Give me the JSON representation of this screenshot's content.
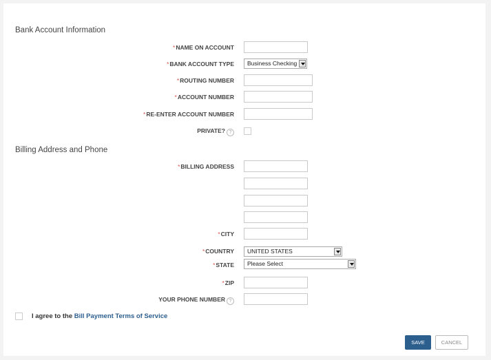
{
  "sections": {
    "bank": "Bank Account Information",
    "billing": "Billing Address and Phone"
  },
  "bank_fields": {
    "name_on_account": "NAME ON ACCOUNT",
    "account_type": "BANK ACCOUNT TYPE",
    "account_type_value": "Business Checking",
    "routing_number": "ROUTING NUMBER",
    "account_number": "ACCOUNT NUMBER",
    "reenter_account_number": "RE-ENTER ACCOUNT NUMBER",
    "private": "PRIVATE?"
  },
  "billing_fields": {
    "billing_address": "BILLING ADDRESS",
    "city": "CITY",
    "country": "COUNTRY",
    "country_value": "UNITED STATES",
    "state": "STATE",
    "state_value": "Please Select",
    "zip": "ZIP",
    "phone": "YOUR PHONE NUMBER"
  },
  "required_marker": "*",
  "agree": {
    "prefix": "I agree to the ",
    "link": "Bill Payment Terms of Service"
  },
  "buttons": {
    "save": "SAVE",
    "cancel": "CANCEL"
  },
  "colors": {
    "required": "#d9534f",
    "link": "#2b5d8e",
    "save_bg": "#2d5f8e"
  }
}
